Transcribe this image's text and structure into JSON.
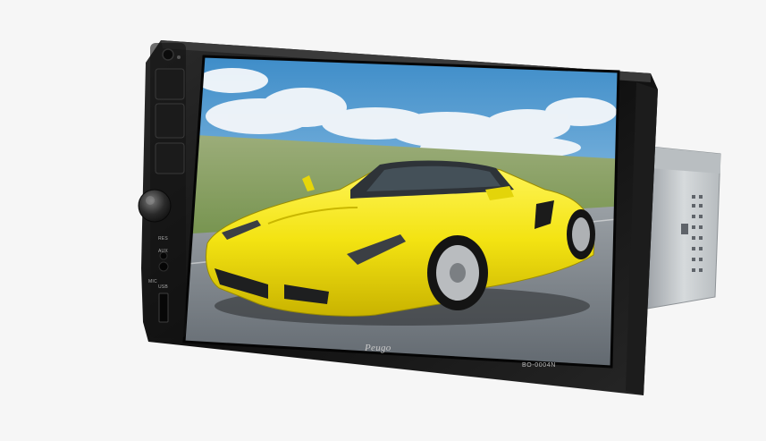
{
  "device": {
    "brand_label": "Peugo",
    "model_label": "BO-0004N",
    "side_labels": [
      "RES",
      "AUX",
      "MIC",
      "USB"
    ]
  },
  "icons": {
    "power": "power-icon",
    "home": "home-icon",
    "back": "back-icon",
    "volume_knob": "volume-knob-icon",
    "microphone": "microphone-icon",
    "usb": "usb-port-icon"
  },
  "colors": {
    "bezel": "#151515",
    "screen_sky": "#6fa8d8",
    "screen_grass": "#7c9b55",
    "road": "#777d82",
    "car_yellow": "#f2e30d",
    "chassis": "#c8cdd1"
  }
}
